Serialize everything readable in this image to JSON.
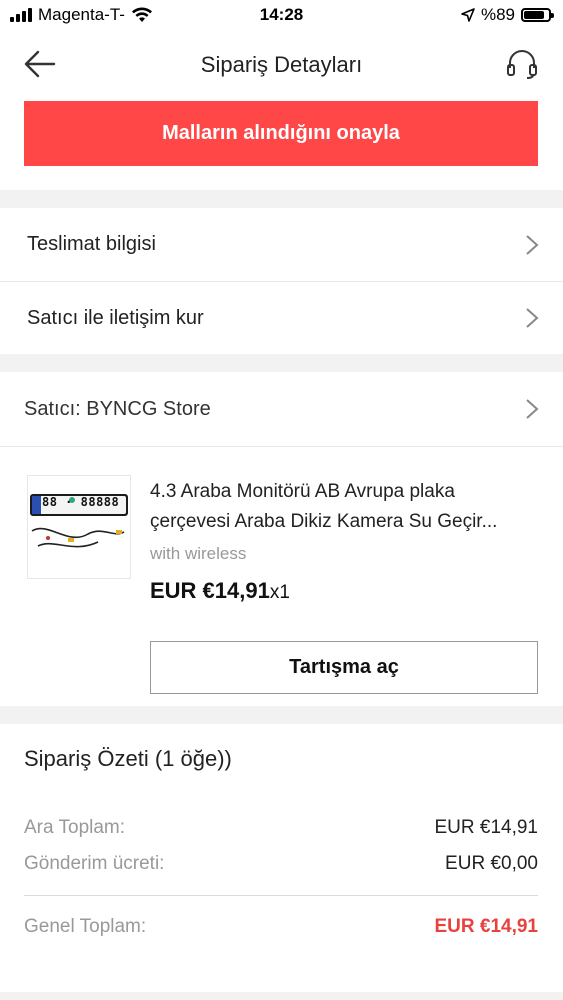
{
  "status_bar": {
    "carrier": "Magenta-T-",
    "time": "14:28",
    "battery_pct": "%89",
    "battery_level": 0.89
  },
  "nav": {
    "title": "Sipariş Detayları",
    "back_icon": "arrow-left-icon",
    "support_icon": "headset-icon"
  },
  "confirm_button": {
    "label": "Malların alındığını onayla",
    "color": "#ff4747"
  },
  "rows": {
    "delivery": "Teslimat bilgisi",
    "contact": "Satıcı ile iletişim kur"
  },
  "seller": {
    "label": "Satıcı: BYNCG Store"
  },
  "product": {
    "title_line1": "4.3 Araba Monitörü AB Avrupa plaka",
    "title_line2": "çerçevesi Araba Dikiz Kamera Su Geçir...",
    "variant": "with wireless",
    "price": "EUR €14,91",
    "quantity": "x1",
    "image_plate_text": "88 · 88888"
  },
  "dispute_button": {
    "label": "Tartışma aç"
  },
  "summary": {
    "title": "Sipariş Özeti  (1 öğe))",
    "subtotal_label": "Ara Toplam:",
    "subtotal_value": "EUR €14,91",
    "shipping_label": "Gönderim ücreti:",
    "shipping_value": "EUR €0,00",
    "total_label": "Genel Toplam:",
    "total_value": "EUR €14,91",
    "total_color": "#e8423f"
  }
}
